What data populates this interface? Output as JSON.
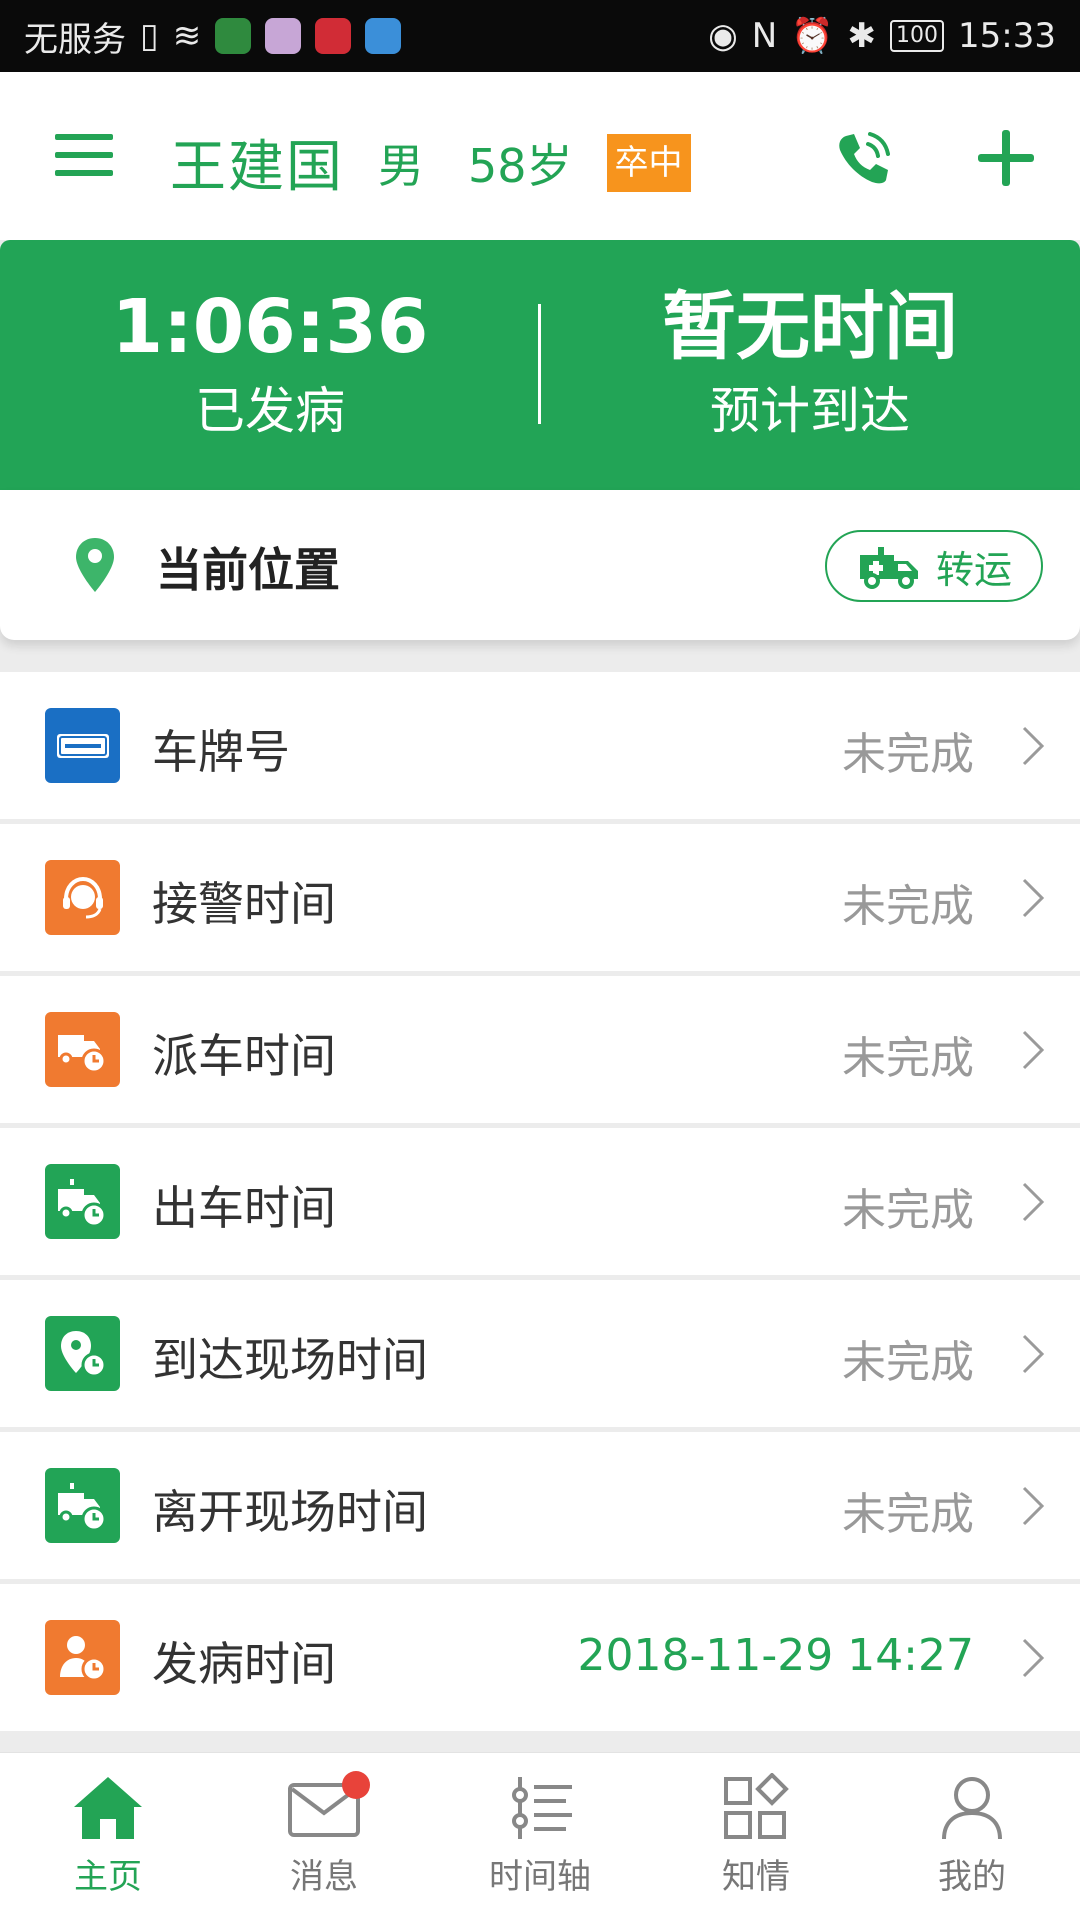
{
  "status_bar": {
    "carrier": "无服务",
    "time": "15:33",
    "battery": "100"
  },
  "header": {
    "patient_name": "王建国",
    "gender": "男",
    "age": "58岁",
    "diagnosis_badge": "卒中"
  },
  "banner": {
    "elapsed_value": "1:06:36",
    "elapsed_label": "已发病",
    "eta_value": "暂无时间",
    "eta_label": "预计到达"
  },
  "location": {
    "label": "当前位置",
    "transfer_label": "转运"
  },
  "items": [
    {
      "label": "车牌号",
      "status": "未完成",
      "icon": "license-plate-icon",
      "color": "#1a6fc4"
    },
    {
      "label": "接警时间",
      "status": "未完成",
      "icon": "headset-icon",
      "color": "#f07a30"
    },
    {
      "label": "派车时间",
      "status": "未完成",
      "icon": "ambulance-clock-icon",
      "color": "#f07a30"
    },
    {
      "label": "出车时间",
      "status": "未完成",
      "icon": "ambulance-clock-icon",
      "color": "#22a456"
    },
    {
      "label": "到达现场时间",
      "status": "未完成",
      "icon": "location-clock-icon",
      "color": "#22a456"
    },
    {
      "label": "离开现场时间",
      "status": "未完成",
      "icon": "ambulance-clock-icon",
      "color": "#22a456"
    },
    {
      "label": "发病时间",
      "status": "2018-11-29 14:27",
      "icon": "person-clock-icon",
      "color": "#f07a30"
    }
  ],
  "nav": {
    "home": "主页",
    "messages": "消息",
    "timeline": "时间轴",
    "consent": "知情",
    "mine": "我的"
  },
  "colors": {
    "primary": "#23a455",
    "badge": "#f7941d",
    "notification": "#e8433a"
  }
}
